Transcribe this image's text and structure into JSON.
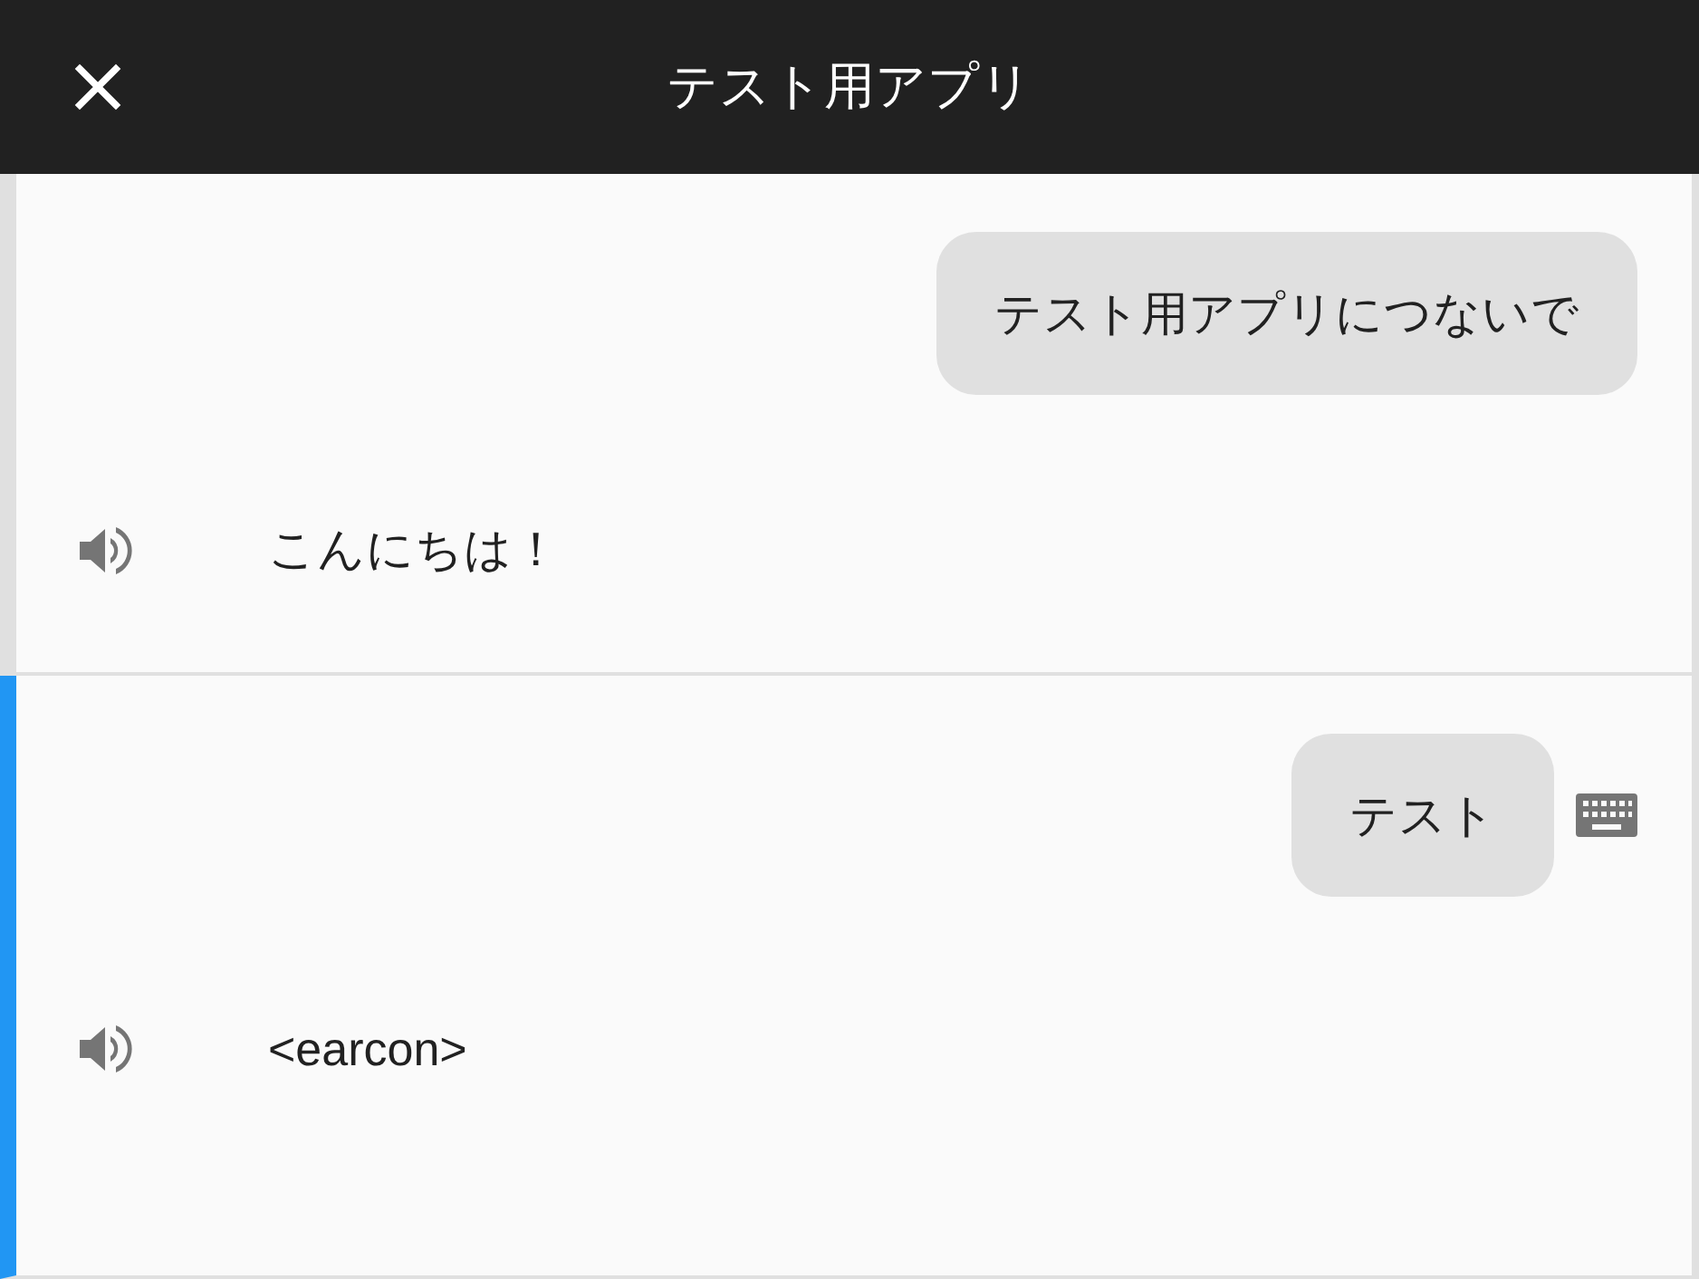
{
  "header": {
    "title": "テスト用アプリ"
  },
  "turns": [
    {
      "selected": false,
      "query": "テスト用アプリにつないで",
      "typed": false,
      "response": "こんにちは！"
    },
    {
      "selected": true,
      "query": "テスト",
      "typed": true,
      "response": "<earcon>"
    }
  ]
}
